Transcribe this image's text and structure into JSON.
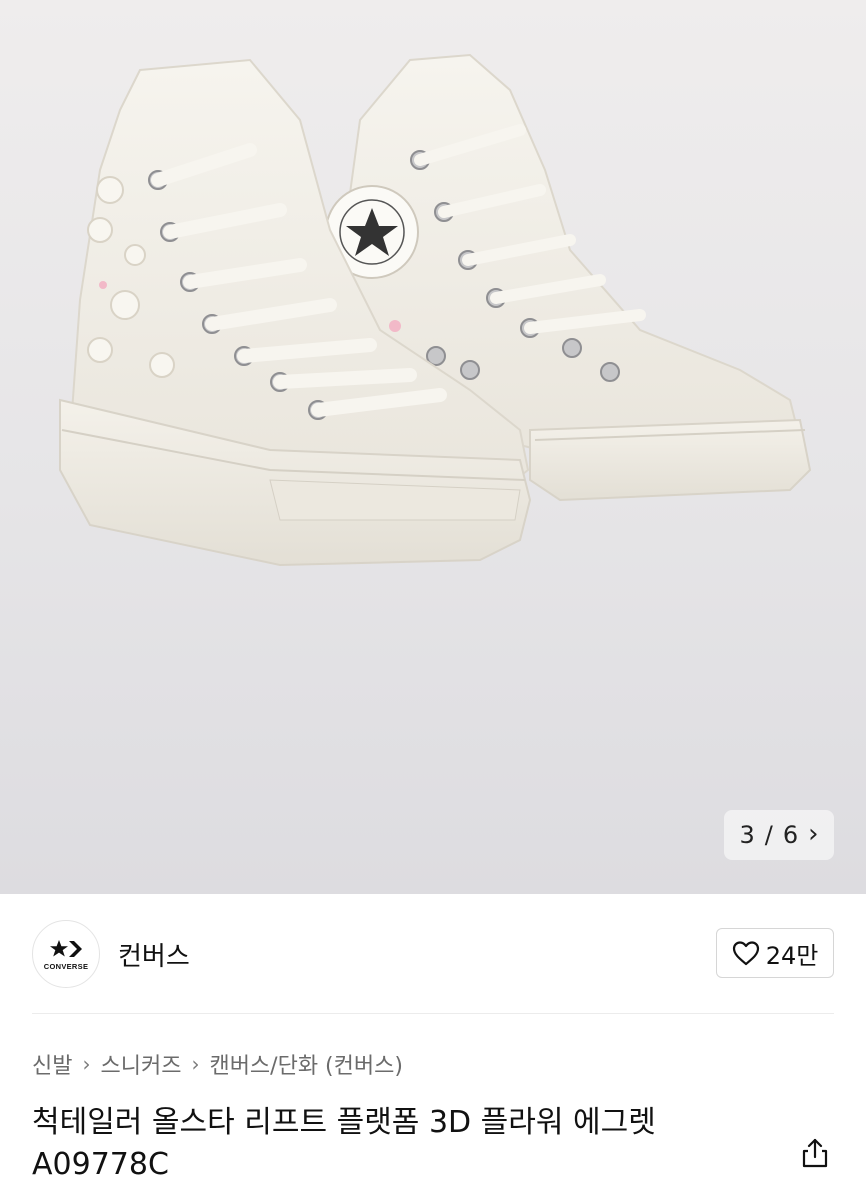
{
  "hero": {
    "pager": {
      "current": "3",
      "separator": "/",
      "total": "6"
    }
  },
  "brand": {
    "name": "컨버스",
    "logo_text": "CONVERSE",
    "likes": "24만"
  },
  "breadcrumb": {
    "items": [
      "신발",
      "스니커즈",
      "캔버스/단화 (컨버스)"
    ]
  },
  "product": {
    "title_line1": "척테일러 올스타 리프트 플랫폼 3D 플라워 에그렛",
    "title_line2": "A09778C"
  },
  "colors": {
    "background": "#ffffff",
    "hero_bg": "#e6e5e7",
    "shoe": "#f3f0e8",
    "text": "#111111",
    "muted_text": "#6b6b6b"
  }
}
